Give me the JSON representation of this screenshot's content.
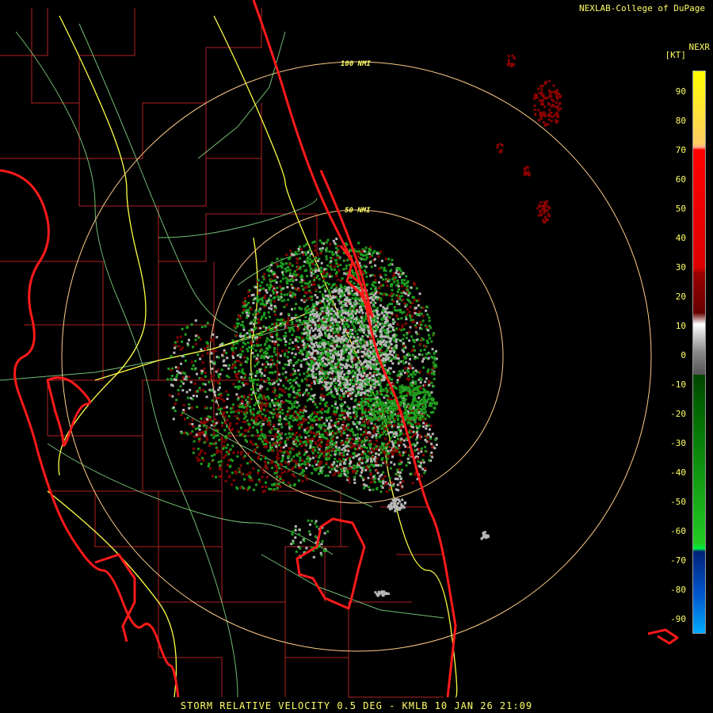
{
  "credit": "NEXLAB-College of DuPage",
  "product_code": "NEXR",
  "units": "[KT]",
  "ring_labels": {
    "inner": "50 NMI",
    "outer": "100 NMI"
  },
  "caption": "STORM RELATIVE VELOCITY 0.5 DEG - KMLB 10 JAN 26 21:09",
  "scale_ticks": [
    "90",
    "80",
    "70",
    "60",
    "50",
    "40",
    "30",
    "20",
    "10",
    "0",
    "-10",
    "-20",
    "-30",
    "-40",
    "-50",
    "-60",
    "-70",
    "-80",
    "-90"
  ],
  "colors": {
    "coast": "#ff1a1a",
    "county": "#b22222",
    "highway": "#ffff44",
    "road": "#88dd88",
    "ring": "#ffcc88",
    "inbound": "#1e9e1e",
    "outbound": "#8b0000",
    "neutral": "#b8b8b8"
  }
}
